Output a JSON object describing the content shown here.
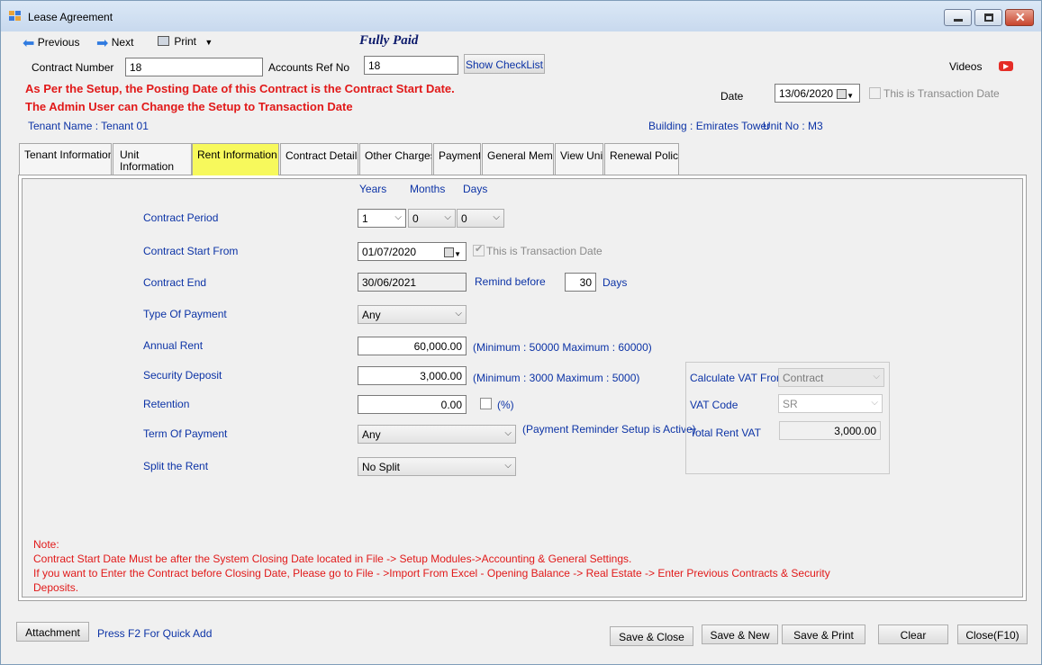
{
  "window": {
    "title": "Lease Agreement"
  },
  "toolbar": {
    "previous": "Previous",
    "next": "Next",
    "print": "Print",
    "status": "Fully Paid",
    "videos": "Videos"
  },
  "header": {
    "contract_number_label": "Contract Number",
    "contract_number": "18",
    "accounts_ref_label": "Accounts Ref No",
    "accounts_ref": "18",
    "show_checklist": "Show CheckList",
    "warning1": "As Per the Setup, the Posting Date of this Contract is the Contract Start Date.",
    "warning2": "The Admin User can Change the Setup to Transaction Date",
    "date_label": "Date",
    "date": "13/06/2020",
    "is_transaction_date": "This is Transaction Date",
    "tenant": "Tenant Name : Tenant 01",
    "building": "Building : Emirates Tower",
    "unit": "Unit No : M3"
  },
  "tabs": [
    "Tenant Information",
    "Unit Information",
    "Rent Information",
    "Contract Details",
    "Other Charges",
    "Payment",
    "General Memo",
    "View Unit",
    "Renewal Policy"
  ],
  "rent": {
    "col_years": "Years",
    "col_months": "Months",
    "col_days": "Days",
    "contract_period_label": "Contract Period",
    "period_years": "1",
    "period_months": "0",
    "period_days": "0",
    "start_label": "Contract Start From",
    "start_date": "01/07/2020",
    "start_is_transaction": "This is Transaction Date",
    "end_label": "Contract End",
    "end_date": "30/06/2021",
    "remind_label": "Remind before",
    "remind_days": "30",
    "days_label": "Days",
    "type_payment_label": "Type Of Payment",
    "type_payment": "Any",
    "annual_rent_label": "Annual Rent",
    "annual_rent": "60,000.00",
    "annual_rent_hint": "(Minimum : 50000 Maximum : 60000)",
    "security_label": "Security Deposit",
    "security": "3,000.00",
    "security_hint": "(Minimum : 3000 Maximum : 5000)",
    "retention_label": "Retention",
    "retention": "0.00",
    "percent_label": "(%)",
    "term_label": "Term Of Payment",
    "term": "Any",
    "term_hint": "(Payment Reminder Setup is Active)",
    "split_label": "Split the Rent",
    "split": "No Split"
  },
  "vat": {
    "calc_label": "Calculate VAT From",
    "calc_value": "Contract",
    "code_label": "VAT Code",
    "code_value": "SR",
    "total_label": "Total Rent VAT",
    "total_value": "3,000.00"
  },
  "note": {
    "title": "Note:",
    "line1": "Contract Start Date Must be after the System Closing Date located in File -> Setup Modules->Accounting & General Settings.",
    "line2": "If you want to Enter the Contract before Closing Date, Please go to File - >Import From Excel - Opening Balance -> Real Estate -> Enter Previous Contracts & Security",
    "line3": "Deposits."
  },
  "footer": {
    "attachment": "Attachment",
    "quick_add": "Press F2 For Quick Add",
    "save_close": "Save & Close",
    "save_new": "Save & New",
    "save_print": "Save & Print",
    "clear": "Clear",
    "close": "Close(F10)"
  },
  "colors": {
    "label_blue": "#0c33a6",
    "warning_red": "#e11919",
    "active_tab": "#f7f95c"
  }
}
